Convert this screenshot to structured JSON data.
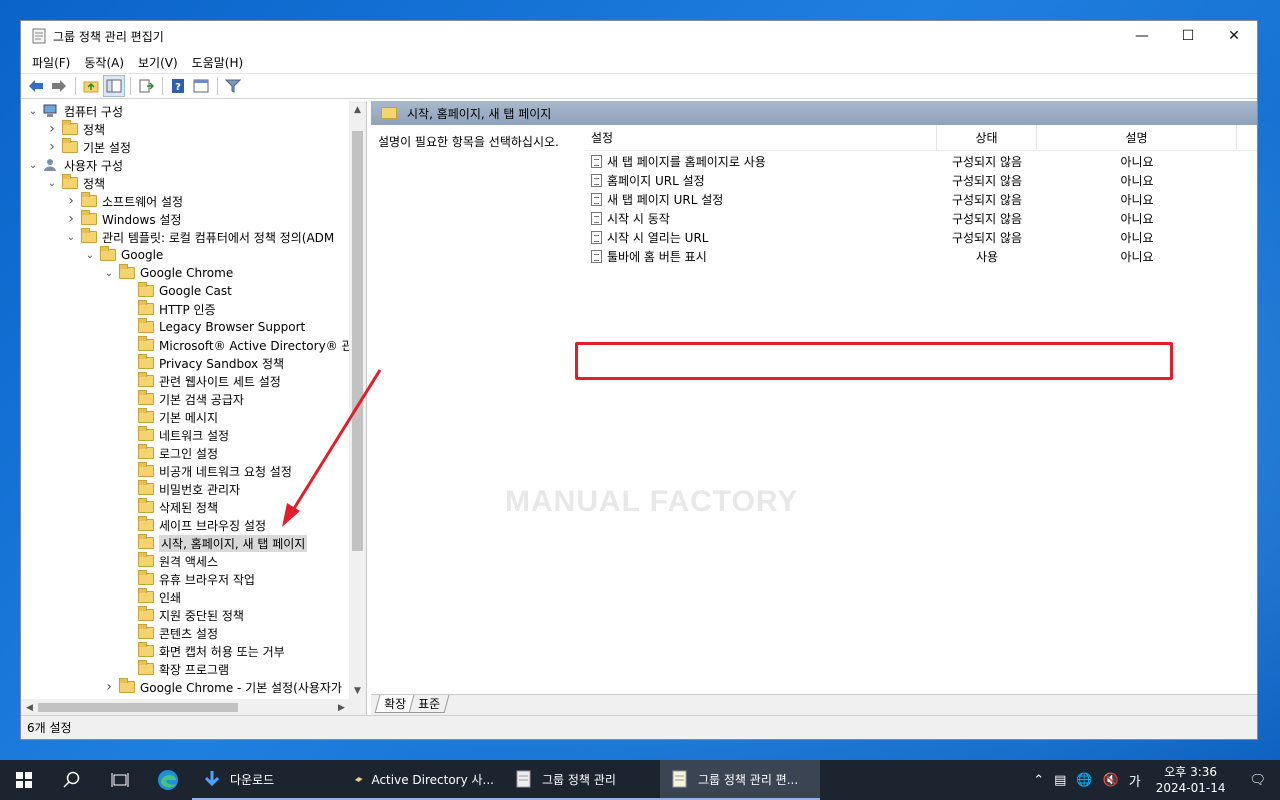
{
  "window": {
    "title": "그룹 정책 관리 편집기"
  },
  "menu": [
    "파일(F)",
    "동작(A)",
    "보기(V)",
    "도움말(H)"
  ],
  "tree": [
    {
      "label": "컴퓨터 구성",
      "level": 0,
      "chev": "down",
      "icon": "computer"
    },
    {
      "label": "정책",
      "level": 1,
      "chev": "right",
      "icon": "folder"
    },
    {
      "label": "기본 설정",
      "level": 1,
      "chev": "right",
      "icon": "folder"
    },
    {
      "label": "사용자 구성",
      "level": 0,
      "chev": "down",
      "icon": "user"
    },
    {
      "label": "정책",
      "level": 1,
      "chev": "down",
      "icon": "folder"
    },
    {
      "label": "소프트웨어 설정",
      "level": 2,
      "chev": "right",
      "icon": "folder"
    },
    {
      "label": "Windows 설정",
      "level": 2,
      "chev": "right",
      "icon": "folder"
    },
    {
      "label": "관리 템플릿: 로컬 컴퓨터에서 정책 정의(ADM",
      "level": 2,
      "chev": "down",
      "icon": "folder"
    },
    {
      "label": "Google",
      "level": 3,
      "chev": "down",
      "icon": "folder"
    },
    {
      "label": "Google Chrome",
      "level": 4,
      "chev": "down",
      "icon": "folder"
    },
    {
      "label": "Google Cast",
      "level": 5,
      "chev": "",
      "icon": "folder"
    },
    {
      "label": "HTTP 인증",
      "level": 5,
      "chev": "",
      "icon": "folder"
    },
    {
      "label": "Legacy Browser Support",
      "level": 5,
      "chev": "",
      "icon": "folder"
    },
    {
      "label": "Microsoft® Active Directory® 관리",
      "level": 5,
      "chev": "",
      "icon": "folder"
    },
    {
      "label": "Privacy Sandbox 정책",
      "level": 5,
      "chev": "",
      "icon": "folder"
    },
    {
      "label": "관련 웹사이트 세트 설정",
      "level": 5,
      "chev": "",
      "icon": "folder"
    },
    {
      "label": "기본 검색 공급자",
      "level": 5,
      "chev": "",
      "icon": "folder"
    },
    {
      "label": "기본 메시지",
      "level": 5,
      "chev": "",
      "icon": "folder"
    },
    {
      "label": "네트워크 설정",
      "level": 5,
      "chev": "",
      "icon": "folder"
    },
    {
      "label": "로그인 설정",
      "level": 5,
      "chev": "",
      "icon": "folder"
    },
    {
      "label": "비공개 네트워크 요청 설정",
      "level": 5,
      "chev": "",
      "icon": "folder"
    },
    {
      "label": "비밀번호 관리자",
      "level": 5,
      "chev": "",
      "icon": "folder"
    },
    {
      "label": "삭제된 정책",
      "level": 5,
      "chev": "",
      "icon": "folder"
    },
    {
      "label": "세이프 브라우징 설정",
      "level": 5,
      "chev": "",
      "icon": "folder"
    },
    {
      "label": "시작, 홈페이지, 새 탭 페이지",
      "level": 5,
      "chev": "",
      "icon": "folder",
      "selected": true
    },
    {
      "label": "원격 액세스",
      "level": 5,
      "chev": "",
      "icon": "folder"
    },
    {
      "label": "유휴 브라우저 작업",
      "level": 5,
      "chev": "",
      "icon": "folder"
    },
    {
      "label": "인쇄",
      "level": 5,
      "chev": "",
      "icon": "folder"
    },
    {
      "label": "지원 중단된 정책",
      "level": 5,
      "chev": "",
      "icon": "folder"
    },
    {
      "label": "콘텐츠 설정",
      "level": 5,
      "chev": "",
      "icon": "folder"
    },
    {
      "label": "화면 캡처 허용 또는 거부",
      "level": 5,
      "chev": "",
      "icon": "folder"
    },
    {
      "label": "확장 프로그램",
      "level": 5,
      "chev": "",
      "icon": "folder"
    },
    {
      "label": "Google Chrome - 기본 설정(사용자가",
      "level": 4,
      "chev": "right",
      "icon": "folder"
    }
  ],
  "right": {
    "header": "시작, 홈페이지, 새 탭 페이지",
    "description": "설명이 필요한 항목을 선택하십시오.",
    "columns": [
      "설정",
      "상태",
      "설명"
    ],
    "rows": [
      {
        "name": "새 탭 페이지를 홈페이지로 사용",
        "state": "구성되지 않음",
        "desc": "아니요"
      },
      {
        "name": "홈페이지 URL 설정",
        "state": "구성되지 않음",
        "desc": "아니요"
      },
      {
        "name": "새 탭 페이지 URL 설정",
        "state": "구성되지 않음",
        "desc": "아니요"
      },
      {
        "name": "시작 시 동작",
        "state": "구성되지 않음",
        "desc": "아니요"
      },
      {
        "name": "시작 시 열리는 URL",
        "state": "구성되지 않음",
        "desc": "아니요"
      },
      {
        "name": "툴바에 홈 버튼 표시",
        "state": "사용",
        "desc": "아니요"
      }
    ],
    "tabs": [
      "확장",
      "표준"
    ]
  },
  "watermark": "MANUAL FACTORY",
  "status": "6개 설정",
  "taskbar": {
    "apps": [
      {
        "label": "다운로드",
        "icon": "download-arrow"
      },
      {
        "label": "Active Directory 사...",
        "icon": "ad-users"
      },
      {
        "label": "그룹 정책 관리",
        "icon": "gpo"
      },
      {
        "label": "그룹 정책 관리 편...",
        "icon": "gpo-editor"
      }
    ],
    "ime": "가",
    "time": "오후 3:36",
    "date": "2024-01-14"
  },
  "colors": {
    "accent_red": "#e01f2b",
    "header_blue": "#97a9c0",
    "taskbar": "#1c2430"
  }
}
